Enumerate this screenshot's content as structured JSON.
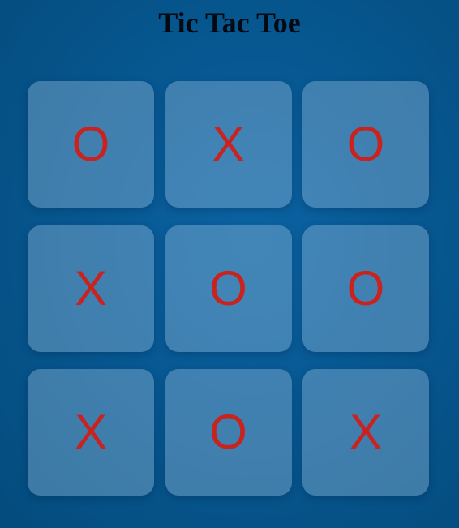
{
  "title": "Tic Tac Toe",
  "colors": {
    "mark": "#c9231f",
    "background": "#075892",
    "cell": "#5f93bf",
    "title": "#050a12"
  },
  "board": {
    "cells": [
      "O",
      "X",
      "O",
      "X",
      "O",
      "O",
      "X",
      "O",
      "X"
    ]
  }
}
